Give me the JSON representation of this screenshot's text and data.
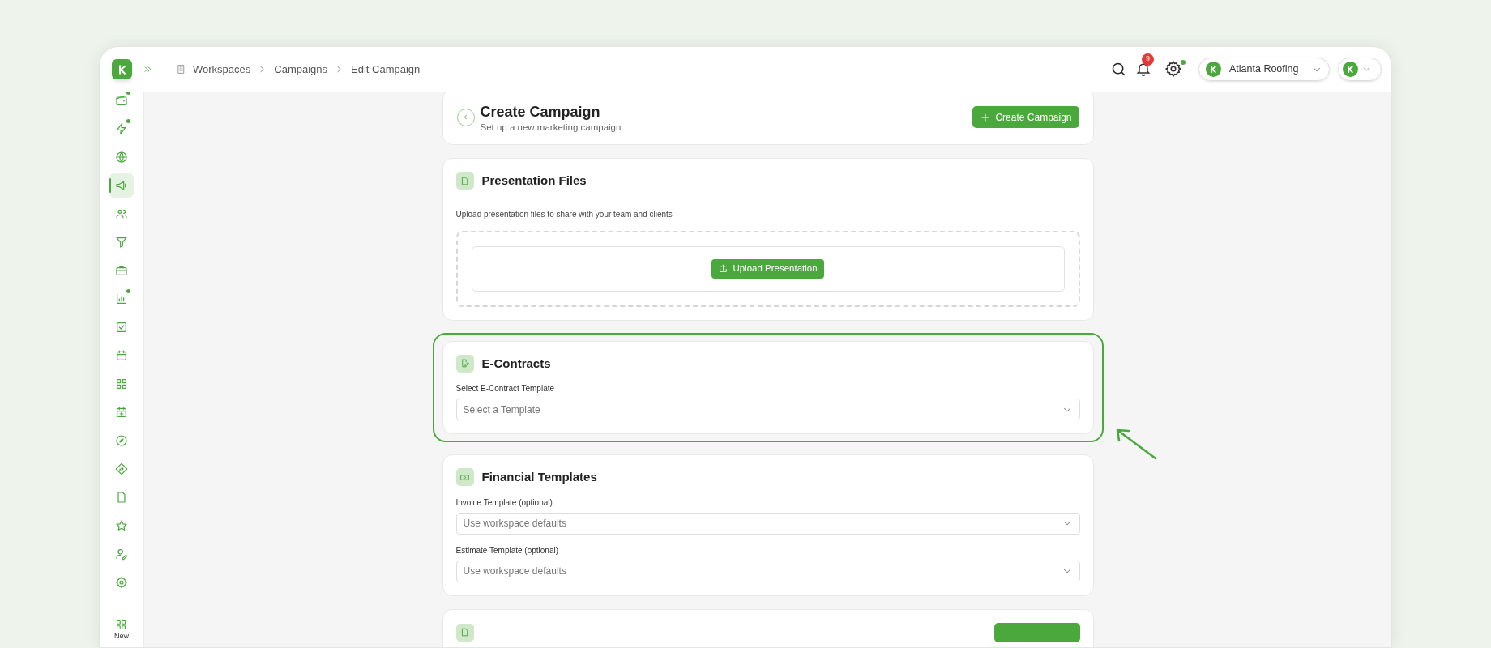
{
  "topbar": {
    "breadcrumbs": [
      {
        "label": "Workspaces"
      },
      {
        "label": "Campaigns"
      },
      {
        "label": "Edit Campaign"
      }
    ],
    "notification_count": "9",
    "settings_dot": true,
    "org_selector": {
      "label": "Atlanta Roofing"
    }
  },
  "sidebar": {
    "items": [
      {
        "selected": false,
        "dot": true
      },
      {
        "selected": false,
        "dot": true
      },
      {
        "selected": false,
        "dot": false
      },
      {
        "selected": true,
        "dot": false
      },
      {
        "selected": false,
        "dot": false
      },
      {
        "selected": false,
        "dot": false
      },
      {
        "selected": false,
        "dot": false
      },
      {
        "selected": false,
        "dot": true
      },
      {
        "selected": false,
        "dot": false
      },
      {
        "selected": false,
        "dot": false
      },
      {
        "selected": false,
        "dot": false
      },
      {
        "selected": false,
        "dot": false
      },
      {
        "selected": false,
        "dot": false
      },
      {
        "selected": false,
        "dot": false
      },
      {
        "selected": false,
        "dot": false
      },
      {
        "selected": false,
        "dot": false
      },
      {
        "selected": false,
        "dot": false
      },
      {
        "selected": false,
        "dot": false
      }
    ],
    "footer_label": "New"
  },
  "header": {
    "title": "Create Campaign",
    "subtitle": "Set up a new marketing campaign",
    "button": "Create Campaign"
  },
  "sections": [
    {
      "kind": "upload",
      "title": "Presentation Files",
      "description": "Upload presentation files to share with your team and clients",
      "button": "Upload Presentation",
      "highlighted": false
    },
    {
      "kind": "fields",
      "title": "E-Contracts",
      "highlighted": true,
      "fields": [
        {
          "label": "Select E-Contract Template",
          "placeholder": "Select a Template"
        }
      ]
    },
    {
      "kind": "fields",
      "title": "Financial Templates",
      "highlighted": false,
      "fields": [
        {
          "label": "Invoice Template (optional)",
          "placeholder": "Use workspace defaults"
        },
        {
          "label": "Estimate Template (optional)",
          "placeholder": "Use workspace defaults"
        }
      ]
    },
    {
      "kind": "partial",
      "highlighted": false
    }
  ]
}
